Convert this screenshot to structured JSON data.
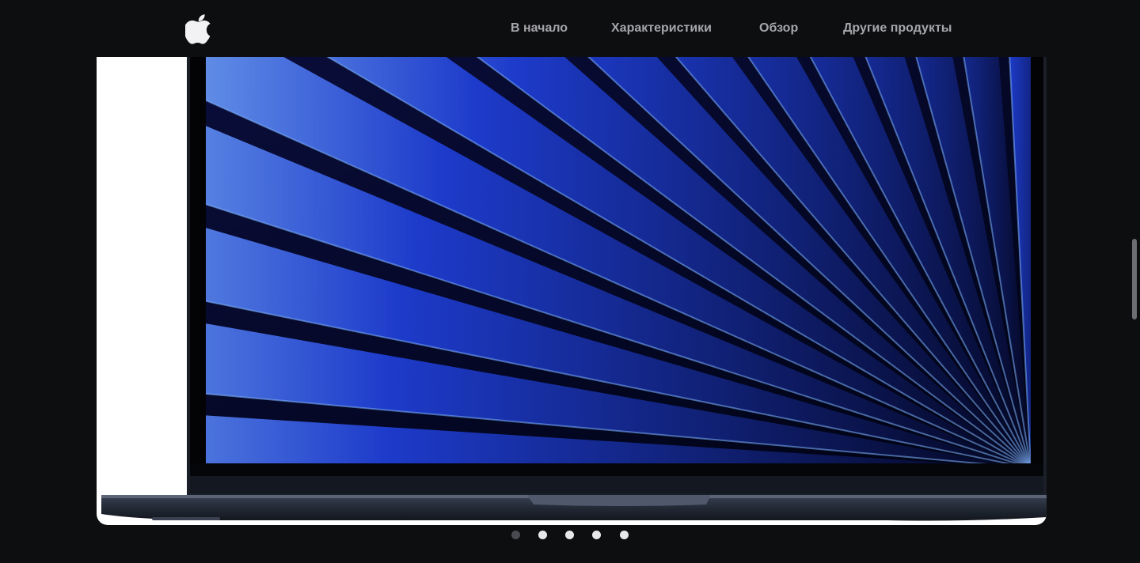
{
  "header": {
    "logo_icon": "apple-logo-icon",
    "nav": [
      {
        "label": "В начало"
      },
      {
        "label": "Характеристики"
      },
      {
        "label": "Обзор"
      },
      {
        "label": "Другие продукты"
      }
    ]
  },
  "slider": {
    "image_subject": "MacBook Air midnight with blue wallpaper",
    "dots_count": 5,
    "active_index": 0
  },
  "colors": {
    "background": "#0d0e10",
    "nav_text": "#a6a6ab",
    "dot_inactive": "#e8e8ea",
    "dot_active": "#4a4b50",
    "wallpaper_deep": "#04061f",
    "wallpaper_mid": "#1f3fd8",
    "wallpaper_light": "#7fb4ff"
  }
}
